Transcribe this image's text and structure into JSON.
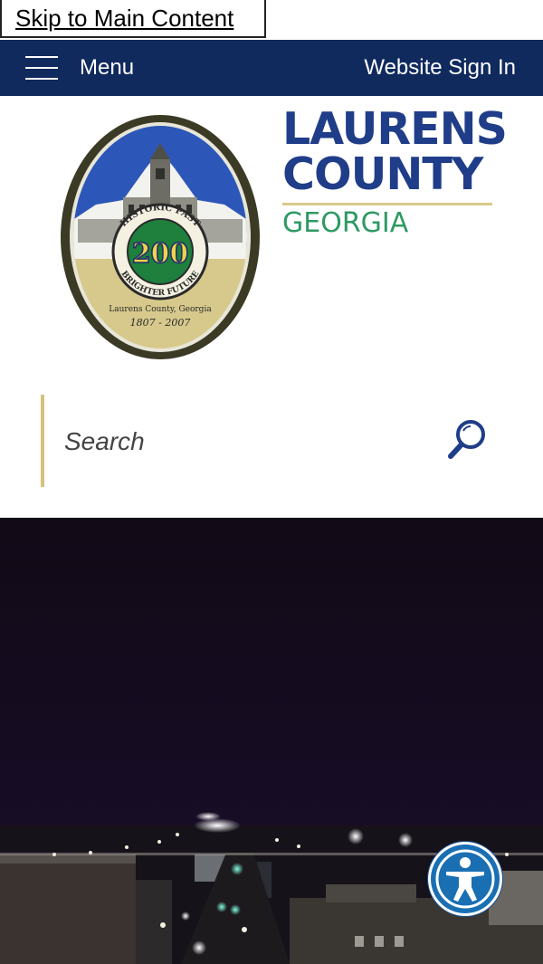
{
  "skip_link": {
    "label": "Skip to Main Content"
  },
  "topbar": {
    "menu_label": "Menu",
    "signin_label": "Website Sign In",
    "background_color": "#102a5e"
  },
  "logo": {
    "seal_number": "200",
    "seal_arc_top": "HISTORIC PAST",
    "seal_arc_bottom": "BRIGHTER FUTURE",
    "seal_place": "Laurens County, Georgia",
    "seal_years": "1807 - 2007",
    "wordmark_line1": "LAURENS",
    "wordmark_line2": "COUNTY",
    "wordmark_line3": "GEORGIA",
    "wordmark_color": "#1f3d88",
    "state_color": "#2e9a62"
  },
  "search": {
    "placeholder": "Search",
    "icon": "magnifier-icon",
    "accent_color": "#d5c27b"
  },
  "hero": {
    "image": "night-city-view"
  },
  "accessibility": {
    "icon": "accessibility-person-icon",
    "color": "#1a6fb3"
  }
}
